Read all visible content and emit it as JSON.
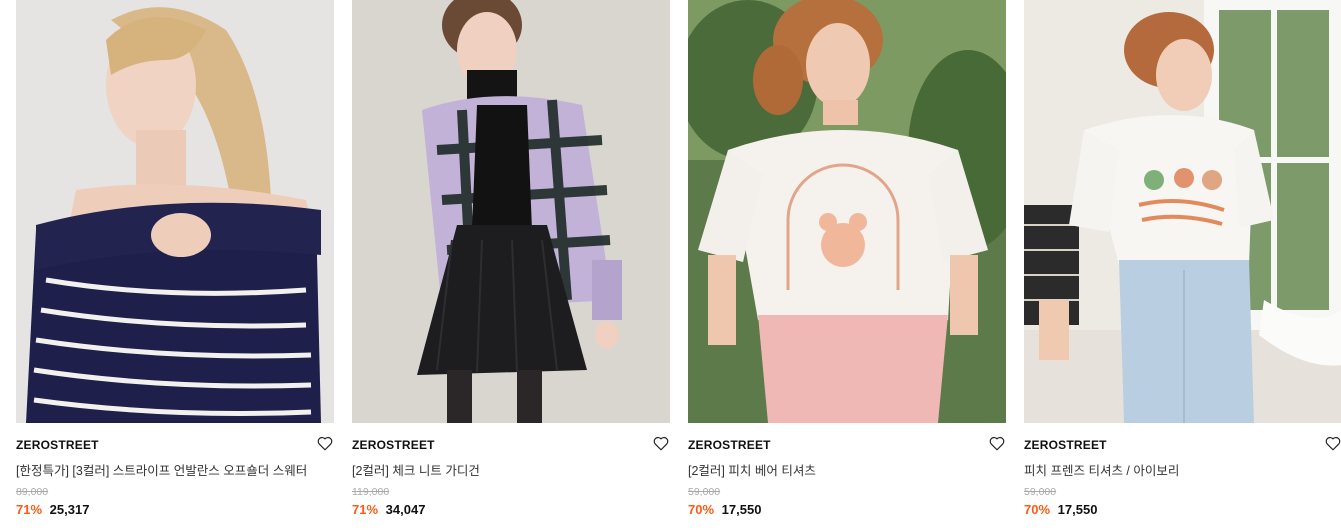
{
  "products": [
    {
      "brand": "ZEROSTREET",
      "name": "[한정특가] [3컬러] 스트라이프 언발란스 오프숄더 스웨터",
      "original_price": "89,000",
      "discount": "71%",
      "price": "25,317",
      "image": "woman in navy and white striped off-shoulder sweater",
      "wishlist_icon": "heart-outline-icon"
    },
    {
      "brand": "ZEROSTREET",
      "name": "[2컬러] 체크 니트 가디건",
      "original_price": "119,000",
      "discount": "71%",
      "price": "34,047",
      "image": "woman in lavender check knit cardigan with black pleated skirt",
      "wishlist_icon": "heart-outline-icon"
    },
    {
      "brand": "ZEROSTREET",
      "name": "[2컬러] 피치 베어 티셔츠",
      "original_price": "59,000",
      "discount": "70%",
      "price": "17,550",
      "image": "woman in white t-shirt with peach bear print and pink pants",
      "wishlist_icon": "heart-outline-icon"
    },
    {
      "brand": "ZEROSTREET",
      "name": "피치 프렌즈 티셔츠 / 아이보리",
      "original_price": "59,000",
      "discount": "70%",
      "price": "17,550",
      "image": "woman in ivory t-shirt sitting by window in light jeans",
      "wishlist_icon": "heart-outline-icon"
    }
  ]
}
